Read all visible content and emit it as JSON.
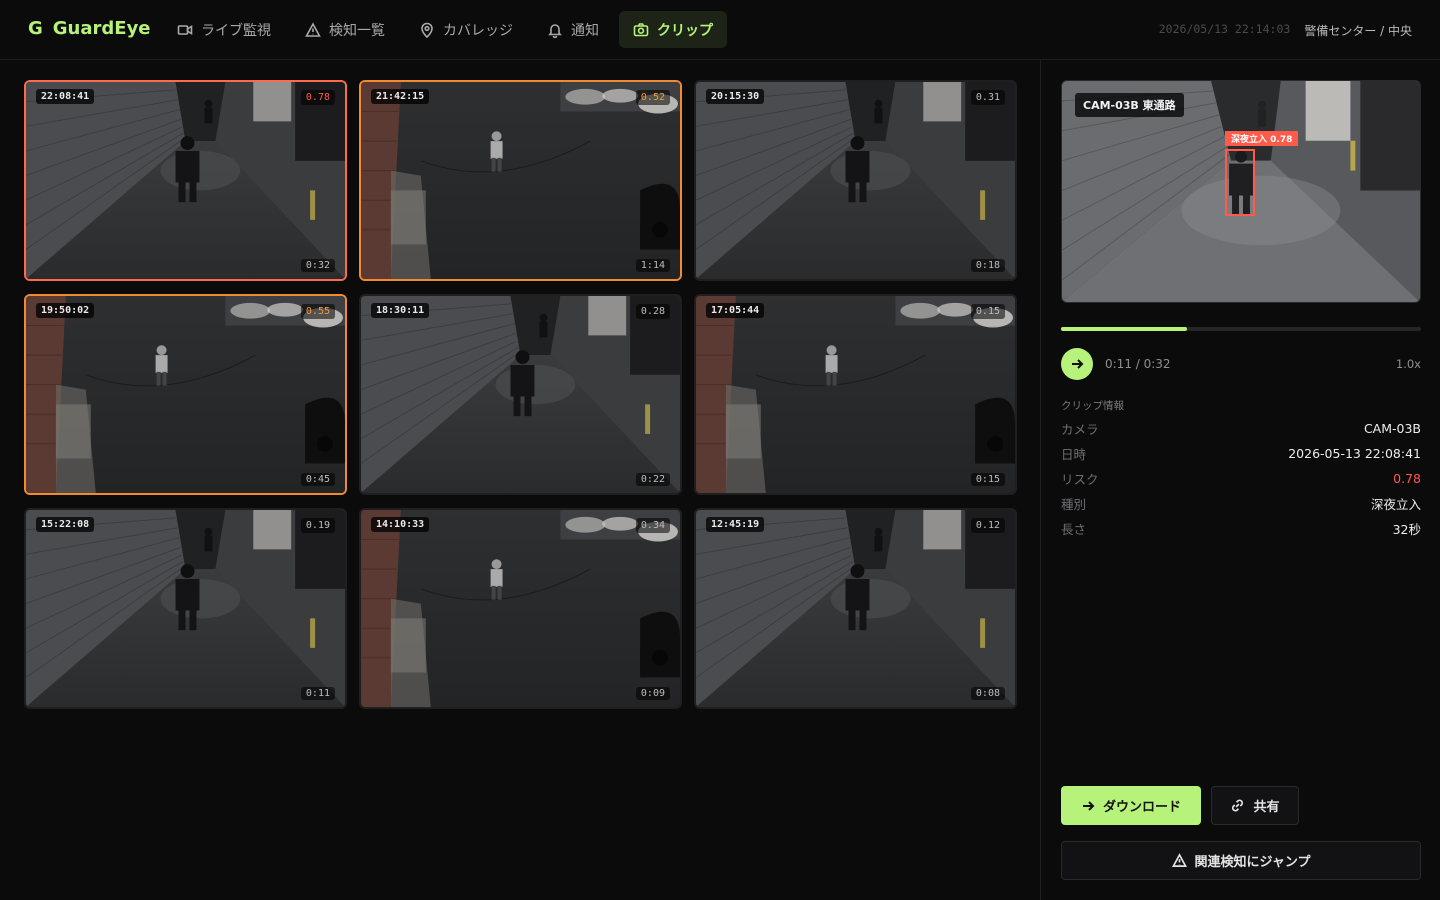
{
  "brand": {
    "mark": "G",
    "name": "GuardEye"
  },
  "nav": [
    {
      "label": "ライブ監視",
      "icon": "video-camera-icon"
    },
    {
      "label": "検知一覧",
      "icon": "warning-triangle-icon"
    },
    {
      "label": "カバレッジ",
      "icon": "map-pin-icon"
    },
    {
      "label": "通知",
      "icon": "bell-icon"
    },
    {
      "label": "クリップ",
      "icon": "camera-icon",
      "active": true
    }
  ],
  "header": {
    "timestamp": "2026/05/13 22:14:03",
    "location": "警備センター / 中央"
  },
  "clips": [
    {
      "time": "22:08:41",
      "score": "0.78",
      "duration": "0:32",
      "level": "red",
      "scene": "corridor"
    },
    {
      "time": "21:42:15",
      "score": "0.52",
      "duration": "1:14",
      "level": "orange",
      "scene": "lot"
    },
    {
      "time": "20:15:30",
      "score": "0.31",
      "duration": "0:18",
      "level": "none",
      "scene": "corridor"
    },
    {
      "time": "19:50:02",
      "score": "0.55",
      "duration": "0:45",
      "level": "orange",
      "scene": "lot"
    },
    {
      "time": "18:30:11",
      "score": "0.28",
      "duration": "0:22",
      "level": "none",
      "scene": "corridor"
    },
    {
      "time": "17:05:44",
      "score": "0.15",
      "duration": "0:15",
      "level": "none",
      "scene": "lot"
    },
    {
      "time": "15:22:08",
      "score": "0.19",
      "duration": "0:11",
      "level": "none",
      "scene": "corridor"
    },
    {
      "time": "14:10:33",
      "score": "0.34",
      "duration": "0:09",
      "level": "none",
      "scene": "lot"
    },
    {
      "time": "12:45:19",
      "score": "0.12",
      "duration": "0:08",
      "level": "none",
      "scene": "corridor"
    }
  ],
  "preview": {
    "camera_tag": "CAM-03B 東通路",
    "detection_label": "深夜立入 0.78",
    "progress_fraction": 0.35,
    "time_text": "0:11 / 0:32",
    "speed": "1.0x"
  },
  "info": {
    "title": "クリップ情報",
    "rows": [
      {
        "key": "カメラ",
        "value": "CAM-03B"
      },
      {
        "key": "日時",
        "value": "2026-05-13 22:08:41"
      },
      {
        "key": "リスク",
        "value": "0.78",
        "risk": true
      },
      {
        "key": "種別",
        "value": "深夜立入"
      },
      {
        "key": "長さ",
        "value": "32秒"
      }
    ]
  },
  "actions": {
    "download": "ダウンロード",
    "share": "共有",
    "jump": "関連検知にジャンプ"
  },
  "colors": {
    "accent": "#b7f27a",
    "alert_red": "#ff5a4a",
    "alert_orange": "#f28a2e",
    "background": "#0b0b0c"
  }
}
